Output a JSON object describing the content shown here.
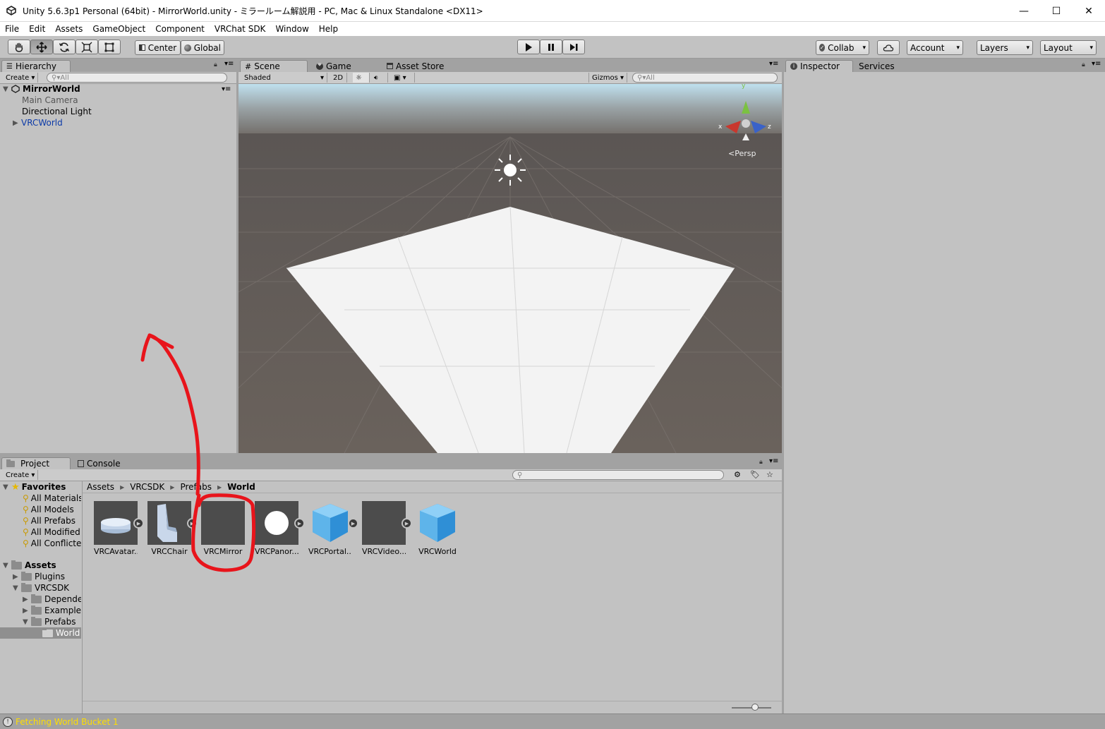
{
  "window": {
    "title": "Unity 5.6.3p1 Personal (64bit) - MirrorWorld.unity - ミラールーム解説用 - PC, Mac & Linux Standalone <DX11>",
    "minimize": "—",
    "maximize": "☐",
    "close": "✕"
  },
  "menu": [
    "File",
    "Edit",
    "Assets",
    "GameObject",
    "Component",
    "VRChat SDK",
    "Window",
    "Help"
  ],
  "toolbar": {
    "pivot": "Center",
    "space": "Global",
    "collab": "Collab",
    "account": "Account",
    "layers": "Layers",
    "layout": "Layout"
  },
  "hierarchy": {
    "tab": "Hierarchy",
    "create": "Create",
    "search_placeholder": "All",
    "scene": "MirrorWorld",
    "items": [
      "Main Camera",
      "Directional Light",
      "VRCWorld"
    ]
  },
  "scene_view": {
    "tabs": [
      "Scene",
      "Game",
      "Asset Store"
    ],
    "shading": "Shaded",
    "mode_2d": "2D",
    "gizmos": "Gizmos",
    "search_placeholder": "All",
    "persp": "Persp",
    "axis_y": "y",
    "axis_x": "x",
    "axis_z": "z"
  },
  "inspector": {
    "tabs": [
      "Inspector",
      "Services"
    ]
  },
  "project": {
    "tabs": [
      "Project",
      "Console"
    ],
    "create": "Create",
    "favorites_label": "Favorites",
    "favorites": [
      "All Materials",
      "All Models",
      "All Prefabs",
      "All Modified",
      "All Conflicte"
    ],
    "assets_label": "Assets",
    "tree": [
      "Plugins",
      "VRCSDK",
      "Depende",
      "Examples",
      "Prefabs",
      "World"
    ],
    "breadcrumb": [
      "Assets",
      "VRCSDK",
      "Prefabs",
      "World"
    ],
    "assets": [
      "VRCAvatar...",
      "VRCChair",
      "VRCMirror",
      "VRCPanor...",
      "VRCPortal...",
      "VRCVideo...",
      "VRCWorld"
    ]
  },
  "status": "Fetching World Bucket 1",
  "colors": {
    "annotation": "#e8141b",
    "status_text": "#ffde00",
    "selection": "#3e7de0"
  }
}
